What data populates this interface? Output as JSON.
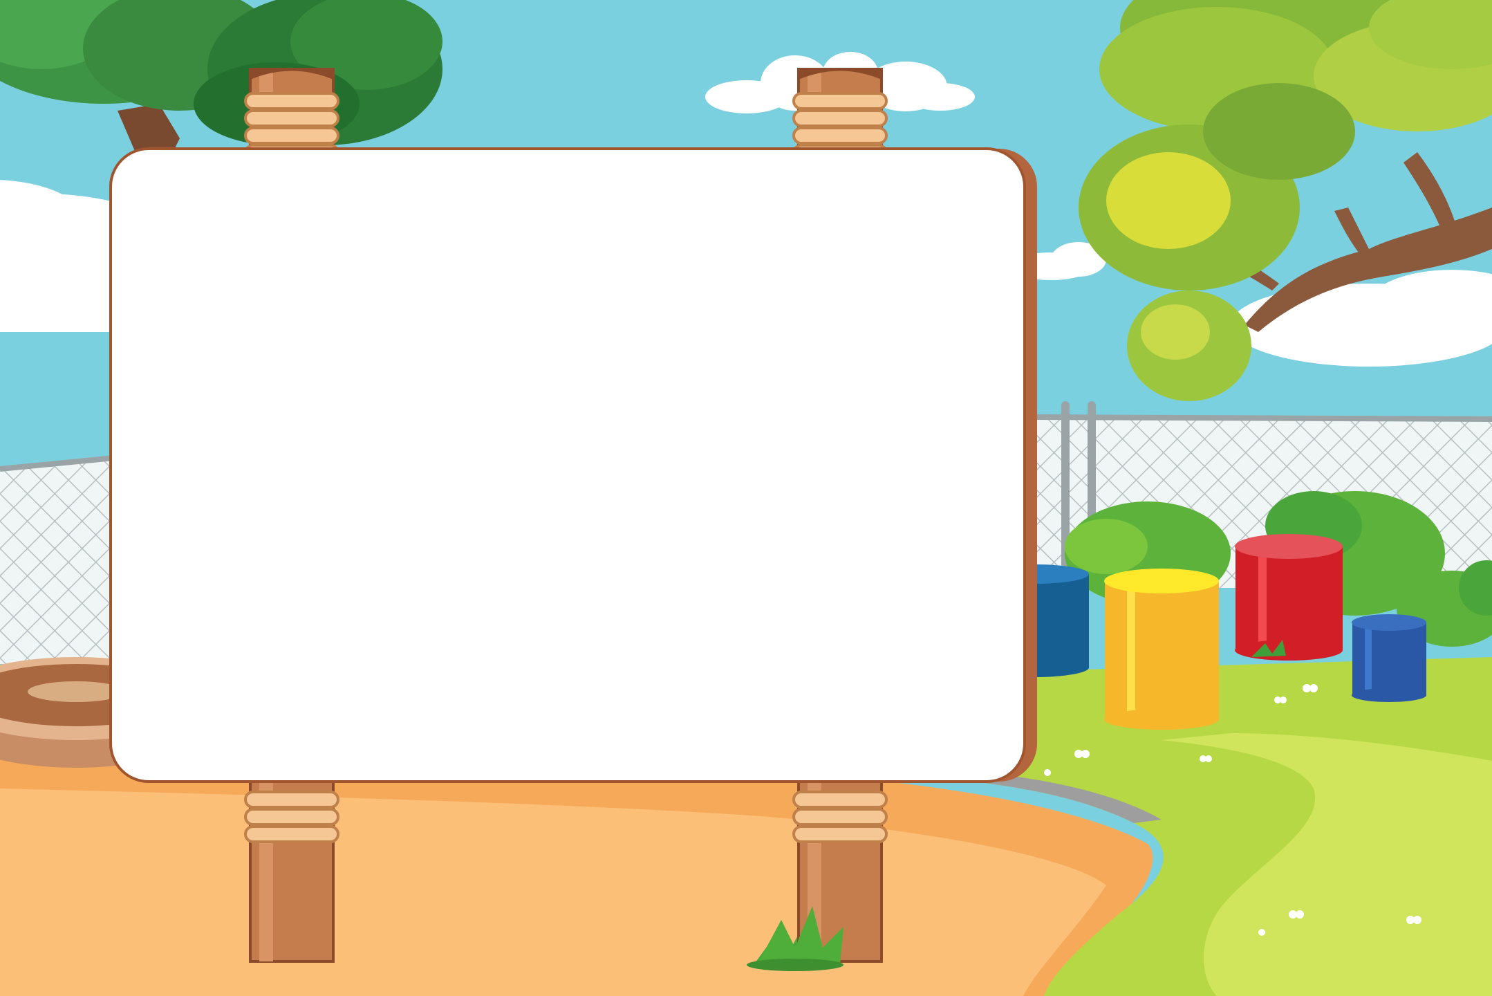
{
  "scene": {
    "description_visible_text": "",
    "palette": {
      "sky": "#7bd0e0",
      "cloud": "#ffffff",
      "tree_dark": "#2f8a3e",
      "tree_mid": "#4fa23a",
      "tree_light": "#b9d63a",
      "trunk": "#8b5a3c",
      "fence": "#a9b2b5",
      "ground_sand": "#f7b46a",
      "ground_sand_light": "#fbc98a",
      "grass": "#b8d94a",
      "grass_light": "#d7ea6a",
      "board_fill": "#ffffff",
      "board_frame": "#b3653d",
      "post": "#c57d4e",
      "rope": "#f4c794",
      "drum_red": "#e0252a",
      "drum_yellow": "#f7c12a",
      "drum_blue": "#2b66b8",
      "drum_navy": "#155f93",
      "bush": "#5fb83a",
      "sandpit": "#c0805a"
    },
    "board": {
      "text": ""
    }
  }
}
